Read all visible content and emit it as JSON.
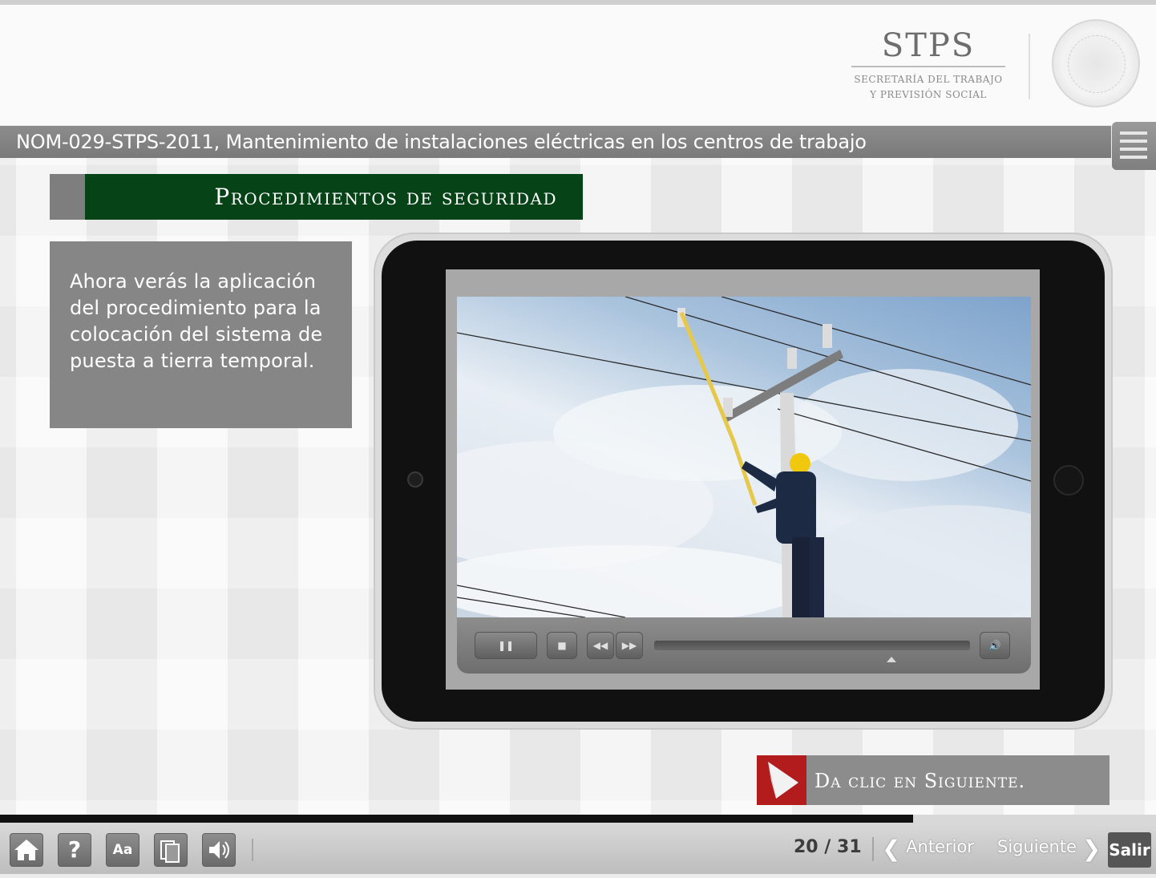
{
  "header": {
    "logo_title": "STPS",
    "logo_subtitle": "SECRETARÍA DEL TRABAJO\nY PREVISIÓN SOCIAL"
  },
  "course_title": "NOM-029-STPS-2011, Mantenimiento de instalaciones eléctricas en los centros de trabajo",
  "section_title": "Procedimientos de seguridad",
  "body_text": "Ahora verás la aplicación del procedimiento para la colocación del sistema de puesta a tierra temporal.",
  "video_player": {
    "controls": [
      "pause-icon",
      "stop-icon",
      "rewind-icon",
      "fast-forward-icon",
      "volume-icon"
    ],
    "progress": 0.75
  },
  "call_to_action": "Da clic en Siguiente.",
  "lesson_progress": 0.79,
  "footer": {
    "buttons": [
      "home-icon",
      "help-icon",
      "font-size-icon",
      "glossary-icon",
      "audio-icon"
    ],
    "help_label": "?",
    "font_label": "Aa",
    "page_current": "20",
    "page_separator": "/",
    "page_total": "31",
    "prev_label": "Anterior",
    "next_label": "Siguiente",
    "exit_label": "Salir"
  },
  "colors": {
    "section_green": "#064317",
    "cta_red": "#b31c1c",
    "panel_gray": "#868686"
  }
}
